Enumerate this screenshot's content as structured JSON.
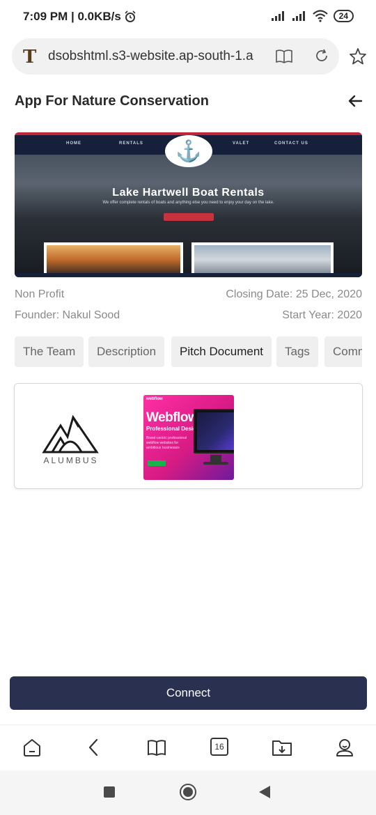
{
  "status_bar": {
    "time_speed": "7:09 PM | 0.0KB/s",
    "battery": "24"
  },
  "browser": {
    "url": "dsobshtml.s3-website.ap-south-1.a",
    "site_icon": "T",
    "tabs_count": "16"
  },
  "page": {
    "title": "App For Nature Conservation"
  },
  "hero": {
    "nav_items": [
      "HOME",
      "RENTALS",
      "VALET",
      "CONTACT US"
    ],
    "title": "Lake Hartwell Boat Rentals",
    "subtitle": "We offer complete rentals of boats and anything else you need to enjoy your day on the lake."
  },
  "meta": {
    "category": "Non Profit",
    "closing_date": "Closing Date: 25 Dec, 2020",
    "founder": "Founder: Nakul Sood",
    "start_year": "Start Year: 2020"
  },
  "tabs": [
    {
      "label": "The Team",
      "active": false
    },
    {
      "label": "Description",
      "active": false
    },
    {
      "label": "Pitch Document",
      "active": true
    },
    {
      "label": "Tags",
      "active": false
    },
    {
      "label": "Comm",
      "active": false
    }
  ],
  "documents": {
    "alumbus_text": "ALUMBUS",
    "webflow": {
      "brand": "webflow",
      "title": "Webflow",
      "subtitle": "Professional Design",
      "description": "Brand-centric professional webflow websites for ambitious businesses"
    }
  },
  "actions": {
    "connect_label": "Connect"
  },
  "colors": {
    "connect_button": "#2a3050",
    "tab_background": "#efefef",
    "webflow_pink": "#ff2fa4"
  },
  "icons": {
    "address_bar": [
      "site-icon",
      "reader-mode-icon",
      "reload-icon",
      "bookmark-star-icon"
    ],
    "toolbar": [
      "home-icon",
      "back-icon",
      "bookmarks-icon",
      "tabs-icon",
      "downloads-icon",
      "profile-icon"
    ]
  }
}
